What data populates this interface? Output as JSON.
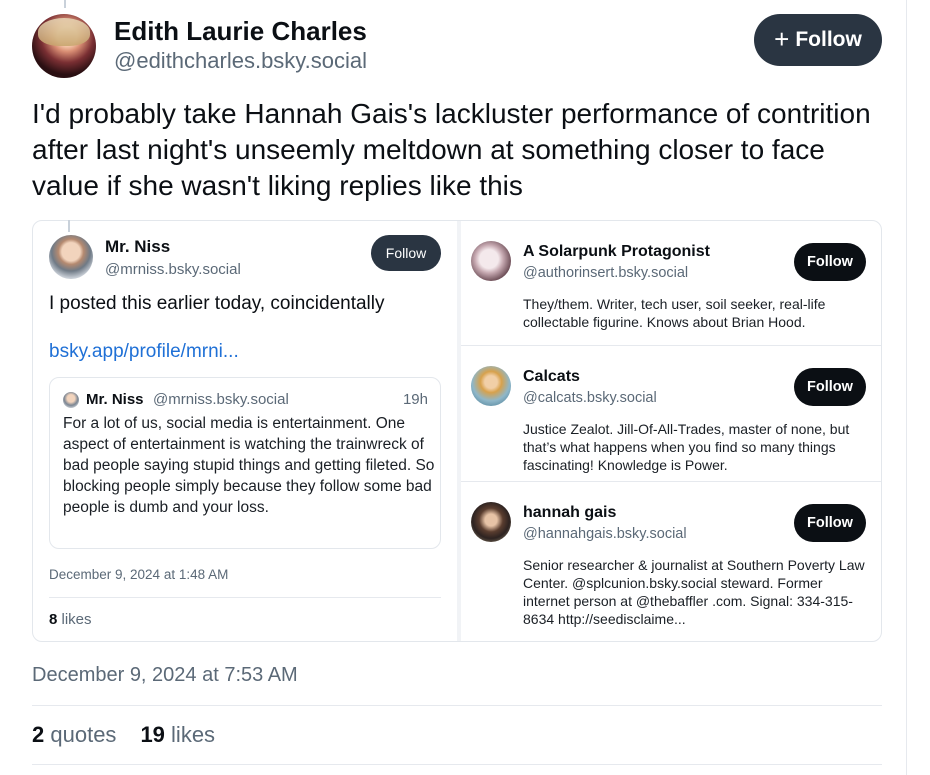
{
  "post": {
    "author_name": "Edith Laurie Charles",
    "author_handle": "@edithcharles.bsky.social",
    "follow_label": "Follow",
    "text": "I'd probably take Hannah Gais's lackluster performance of contrition after last night's unseemly meltdown at something closer to face value if she wasn't liking replies like this",
    "date": "December 9, 2024 at 7:53 AM",
    "quotes_count": "2",
    "quotes_label": "quotes",
    "likes_count": "19",
    "likes_label": "likes"
  },
  "embed": {
    "left": {
      "author_name": "Mr. Niss",
      "author_handle": "@mrniss.bsky.social",
      "follow_label": "Follow",
      "text": "I posted this earlier today, coincidentally",
      "link": "bsky.app/profile/mrni...",
      "quote": {
        "author_name": "Mr. Niss",
        "author_handle": "@mrniss.bsky.social",
        "time": "19h",
        "text": "For a lot of us, social media is entertainment. One aspect of entertainment is watching the trainwreck of bad people saying stupid things and getting fileted.  So blocking people simply because they follow some bad people is dumb and your loss."
      },
      "date": "December 9, 2024 at 1:48 AM",
      "likes_count": "8",
      "likes_label": "likes"
    },
    "users": [
      {
        "name": "A Solarpunk Protagonist",
        "handle": "@authorinsert.bsky.social",
        "follow_label": "Follow",
        "bio": "They/them. Writer, tech user, soil seeker, real-life collectable figurine.  Knows about Brian Hood."
      },
      {
        "name": "Calcats",
        "handle": "@calcats.bsky.social",
        "follow_label": "Follow",
        "bio": "Justice Zealot. Jill-Of-All-Trades, master of none, but that’s what happens when you find so many things fascinating! Knowledge is Power."
      },
      {
        "name": "hannah gais",
        "handle": "@hannahgais.bsky.social",
        "follow_label": "Follow",
        "bio": "Senior researcher & journalist at Southern Poverty Law Center. @splcunion.bsky.social steward. Former internet person at @thebaffler .com. Signal: 334-315-8634 http://seedisclaime..."
      }
    ]
  },
  "colors": {
    "follow_button": "#2a3542",
    "link": "#1f70d6",
    "muted_text": "#5b6977"
  }
}
